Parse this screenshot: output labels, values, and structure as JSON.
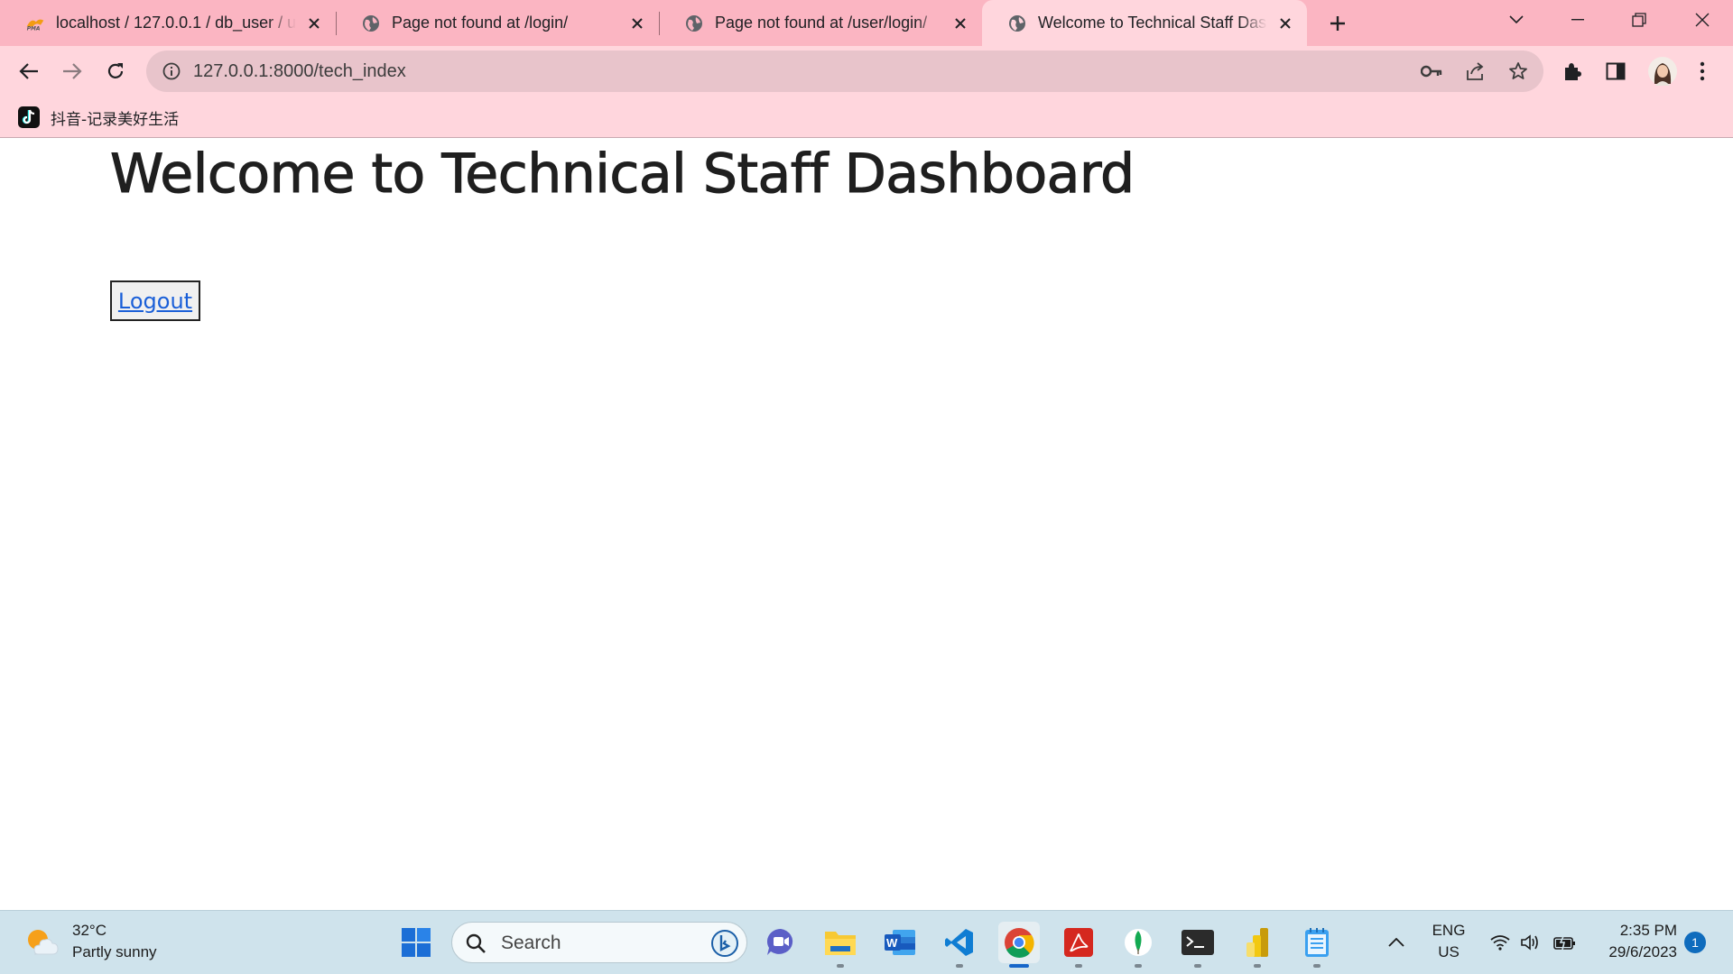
{
  "browser": {
    "tabs": [
      {
        "title": "localhost / 127.0.0.1 / db_user / u",
        "favicon": "phpmyadmin-icon"
      },
      {
        "title": "Page not found at /login/",
        "favicon": "globe-icon"
      },
      {
        "title": "Page not found at /user/login/",
        "favicon": "globe-icon"
      },
      {
        "title": "Welcome to Technical Staff Dashboard",
        "favicon": "globe-icon",
        "active": true
      }
    ],
    "url": "127.0.0.1:8000/tech_index",
    "bookmarks": [
      {
        "label": "抖音-记录美好生活",
        "icon": "tiktok-icon"
      }
    ],
    "colors": {
      "frame": "#fbb5c2",
      "toolbar": "#ffd6dd",
      "omnibox": "#e8c4cb"
    }
  },
  "page": {
    "heading": "Welcome to Technical Staff Dashboard",
    "logout_label": "Logout",
    "link_color": "#1a5fd8"
  },
  "taskbar": {
    "weather": {
      "temp": "32°C",
      "condition": "Partly sunny"
    },
    "search_label": "Search",
    "apps": [
      "windows-start-icon",
      "chat-icon",
      "file-explorer-icon",
      "word-icon",
      "vscode-icon",
      "chrome-icon",
      "acrobat-icon",
      "mongodb-icon",
      "terminal-icon",
      "power-bi-icon",
      "notepad-icon"
    ],
    "tray": {
      "lang_top": "ENG",
      "lang_bottom": "US",
      "time": "2:35 PM",
      "date": "29/6/2023",
      "notifications": "1"
    }
  }
}
